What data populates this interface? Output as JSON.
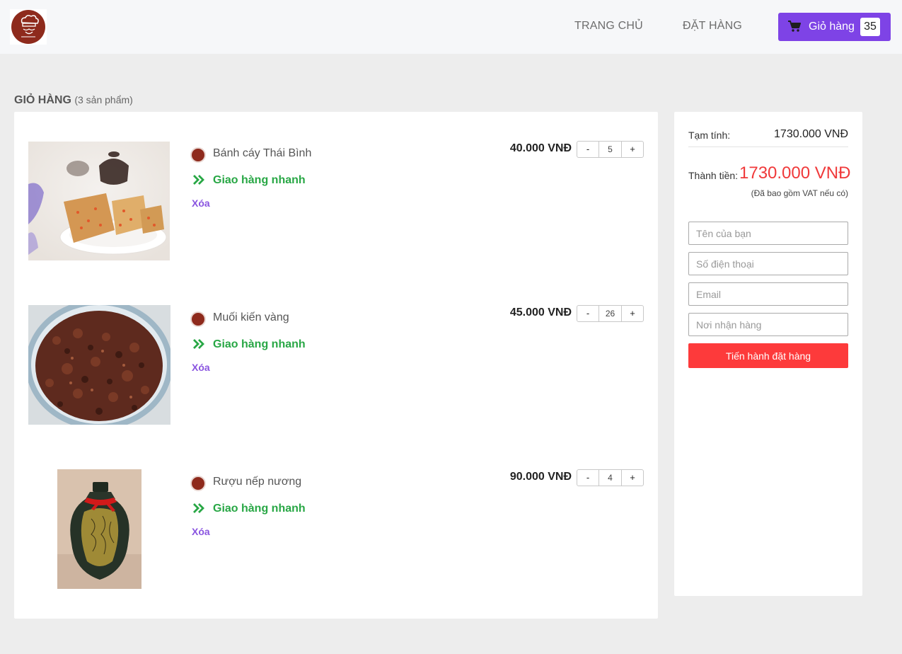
{
  "header": {
    "nav": {
      "home": "TRANG CHỦ",
      "order": "ĐẶT HÀNG"
    },
    "cart": {
      "label": "Giỏ hàng",
      "count": "35"
    }
  },
  "cart": {
    "title": "GIỎ HÀNG",
    "subtitle": "(3 sản phẩm)",
    "items": [
      {
        "name": "Bánh cáy Thái Bình",
        "shipping": "Giao hàng nhanh",
        "remove": "Xóa",
        "price": "40.000 VNĐ",
        "qty": "5"
      },
      {
        "name": "Muối kiến vàng",
        "shipping": "Giao hàng nhanh",
        "remove": "Xóa",
        "price": "45.000 VNĐ",
        "qty": "26"
      },
      {
        "name": "Rượu nếp nương",
        "shipping": "Giao hàng nhanh",
        "remove": "Xóa",
        "price": "90.000 VNĐ",
        "qty": "4"
      }
    ],
    "qty_minus": "-",
    "qty_plus": "+"
  },
  "summary": {
    "subtotal_label": "Tạm tính:",
    "subtotal_value": "1730.000 VNĐ",
    "total_label": "Thành tiền:",
    "total_value": "1730.000 VNĐ",
    "vat_note": "(Đã bao gồm VAT nếu có)",
    "form": {
      "name_placeholder": "Tên của bạn",
      "phone_placeholder": "Số điện thoại",
      "email_placeholder": "Email",
      "address_placeholder": "Nơi nhận hàng",
      "submit_label": "Tiến hành đặt hàng"
    }
  },
  "colors": {
    "accent": "#7e43e6",
    "danger": "#fd3a3b",
    "success": "#28a745",
    "brand": "#8e2a1c"
  }
}
